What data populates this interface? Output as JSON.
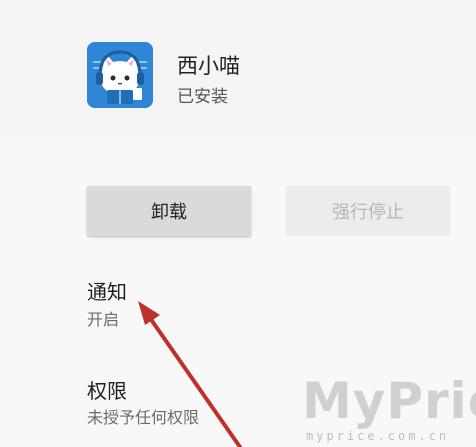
{
  "app": {
    "name": "西小喵",
    "status": "已安装",
    "icon": "cat-reading-app-icon"
  },
  "buttons": {
    "uninstall": "卸载",
    "force_stop": "强行停止"
  },
  "settings": [
    {
      "title": "通知",
      "subtitle": "开启"
    },
    {
      "title": "权限",
      "subtitle": "未授予任何权限"
    }
  ],
  "watermark": {
    "main": "MyPrice",
    "sub": "myprice.com.cn"
  },
  "colors": {
    "annotation_arrow": "#c0302a",
    "icon_background": "#2f86d6"
  }
}
